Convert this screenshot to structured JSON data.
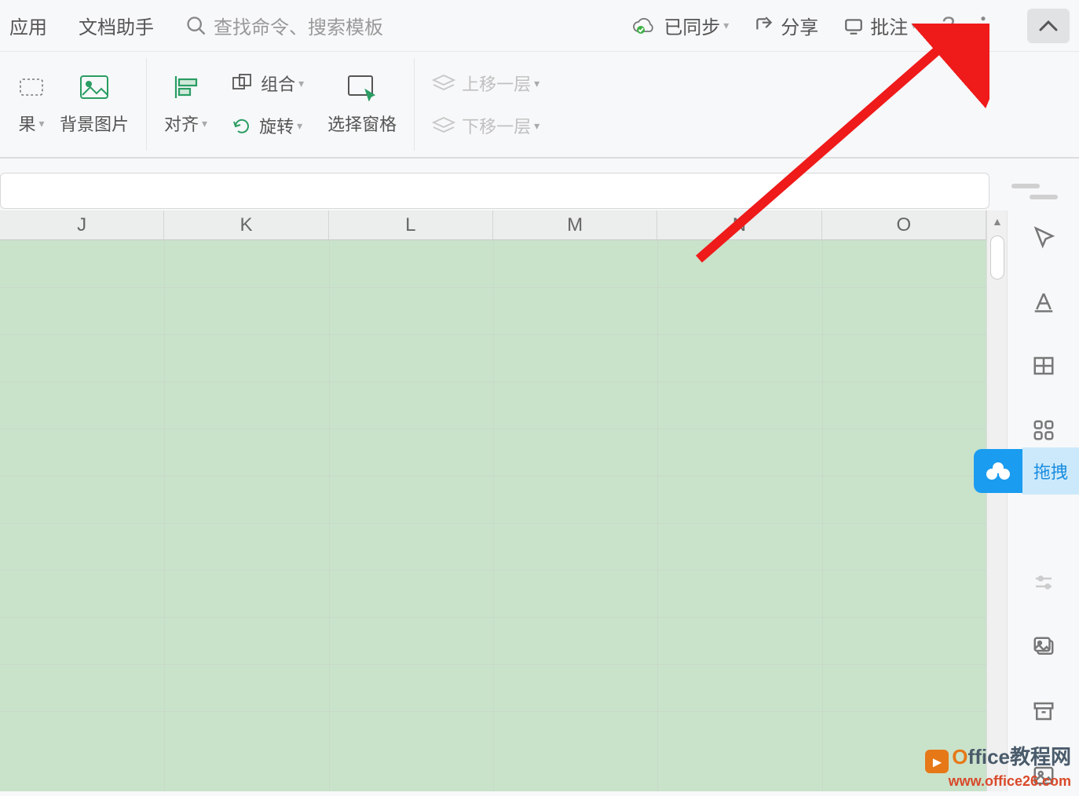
{
  "topbar": {
    "app": "应用",
    "assistant": "文档助手",
    "search_placeholder": "查找命令、搜索模板",
    "sync": "已同步",
    "share": "分享",
    "annotate": "批注"
  },
  "ribbon": {
    "effect": "果",
    "bg_image": "背景图片",
    "align": "对齐",
    "group": "组合",
    "rotate": "旋转",
    "select_pane": "选择窗格",
    "bring_forward": "上移一层",
    "send_backward": "下移一层"
  },
  "columns": [
    "J",
    "K",
    "L",
    "M",
    "N",
    "O"
  ],
  "sidepanel": {
    "drag_label": "拖拽"
  },
  "watermark": {
    "brand": "Office教程网",
    "url": "www.office26.com"
  }
}
